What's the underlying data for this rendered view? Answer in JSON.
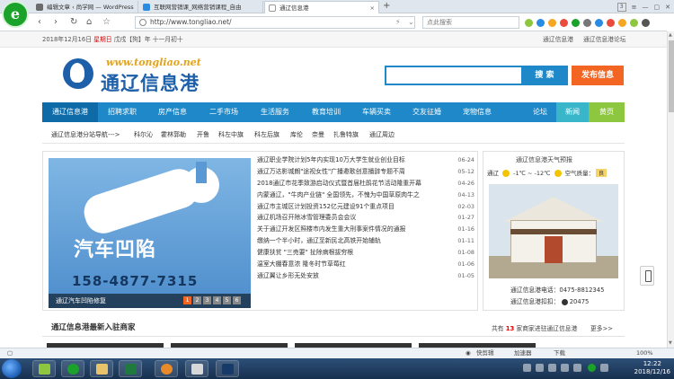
{
  "browser": {
    "logo_letter": "e",
    "tabs": [
      {
        "label": "编辑文章 ‹ 尚学网 — WordPress",
        "active": false
      },
      {
        "label": "互联网营销课_网络营销课程_自由",
        "active": false
      },
      {
        "label": "通辽信息港",
        "active": true
      }
    ],
    "new_tab": "+",
    "tab_count": "3",
    "url": "http://www.tongliao.net/",
    "search_placeholder": "点此搜索",
    "scroll_up": "▲",
    "scroll_down": "▼"
  },
  "topstrip": {
    "date_prefix": "2018年12月16日",
    "weekday": "星期日",
    "lunar": "戊戌【狗】年 十一月初十",
    "link1": "通辽信息港",
    "link2": "通辽信息港论坛"
  },
  "header": {
    "logo_url": "www.tongliao.net",
    "logo_name": "通辽信息港",
    "search_button": "搜 索",
    "publish_button": "发布信息"
  },
  "nav": {
    "items": [
      "通辽信息港",
      "招聘求职",
      "房产信息",
      "二手市场",
      "生活服务",
      "教育培训",
      "车辆买卖",
      "交友征婚",
      "宠物信息"
    ],
    "forum": "论坛",
    "news": "新闻",
    "yellow": "黄页"
  },
  "subnav": {
    "lead": "通辽信息港分站导航--->",
    "items": [
      "科尔沁",
      "霍林郭勒",
      "开鲁",
      "科左中旗",
      "科左后旗",
      "库伦",
      "奈曼",
      "扎鲁特旗",
      "通辽周边"
    ]
  },
  "carousel": {
    "title": "汽车凹陷",
    "phone": "158-4877-7315",
    "caption": "通辽汽车凹陷修复",
    "pages": [
      "1",
      "2",
      "3",
      "4",
      "5",
      "6"
    ],
    "active_page": 1
  },
  "news": [
    {
      "title": "通辽职业学院计划5年内实现10万大学生就业创业目标",
      "date": "06-24"
    },
    {
      "title": "通辽万达影城朗\"途视女性\"广播邀歌创意播辞专题不周",
      "date": "05-12"
    },
    {
      "title": "2018通辽市花季致游启动仪式暨首届杜鹃花节活动隆重开幕",
      "date": "04-26"
    },
    {
      "title": "内蒙通辽，\"牛肉产业链\" 全国领先，不愧为中国草原肉牛之",
      "date": "04-13"
    },
    {
      "title": "通辽市主城区计划投资152亿元建设91个重点项目",
      "date": "02-03"
    },
    {
      "title": "通辽机场召开除冰雪管理委员会会议",
      "date": "01-27"
    },
    {
      "title": "关于通辽开发区照楼市内发生重大刑事案件情况的通报",
      "date": "01-16"
    },
    {
      "title": "缴纳一个半小时，通辽至新民北高铁开始辅轨",
      "date": "01-11"
    },
    {
      "title": "健康扶贫 \"三売要\" 扯除病根拔穷根",
      "date": "01-08"
    },
    {
      "title": "温室大棚春意浓 隆冬时节草莓红",
      "date": "01-06"
    },
    {
      "title": "通辽翼让乡形无处安放",
      "date": "01-05"
    }
  ],
  "weather": {
    "title": "通辽信息港天气预报",
    "city": "通辽",
    "temp": "-1℃ ~ -12℃",
    "aqi_label": "空气质量：",
    "aqi_value": "良",
    "tel": "通辽信息港电话：0475-8812345",
    "qq": "通辽信息港扣扣：",
    "qq_number": "20475"
  },
  "merchants": {
    "title": "通辽信息港最新入驻商家",
    "count_prefix": "共有",
    "count": "13",
    "count_suffix": "家商家进驻通辽信息港",
    "more": "更多>>"
  },
  "statusbar": {
    "speed": "快剪辑",
    "assist": "加速器",
    "download": "下载",
    "zoom": "100%"
  },
  "taskbar": {
    "time": "12:22",
    "date": "2018/12/16"
  }
}
